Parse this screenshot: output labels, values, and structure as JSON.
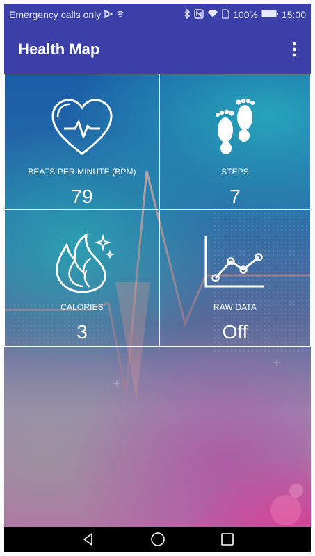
{
  "status_bar": {
    "carrier_text": "Emergency calls only",
    "battery": "100%",
    "time": "15:00",
    "icons": [
      "play-store-icon",
      "wifi-calling-icon",
      "bluetooth-icon",
      "nfc-icon",
      "wifi-icon",
      "sim-icon",
      "battery-icon"
    ]
  },
  "app_bar": {
    "title": "Health Map",
    "menu_icon": "overflow-menu-icon"
  },
  "tiles": [
    {
      "label": "BEATS PER MINUTE (BPM)",
      "value": "79",
      "icon": "heart-pulse-icon"
    },
    {
      "label": "STEPS",
      "value": "7",
      "icon": "footprints-icon"
    },
    {
      "label": "CALORIES",
      "value": "3",
      "icon": "flame-icon"
    },
    {
      "label": "RAW DATA",
      "value": "Off",
      "icon": "line-chart-icon"
    }
  ],
  "nav_bar": {
    "icons": [
      "back-icon",
      "home-icon",
      "recents-icon"
    ]
  },
  "colors": {
    "primary": "#3a40a8",
    "tile_border": "#ffffff",
    "nav_bar": "#000000"
  }
}
